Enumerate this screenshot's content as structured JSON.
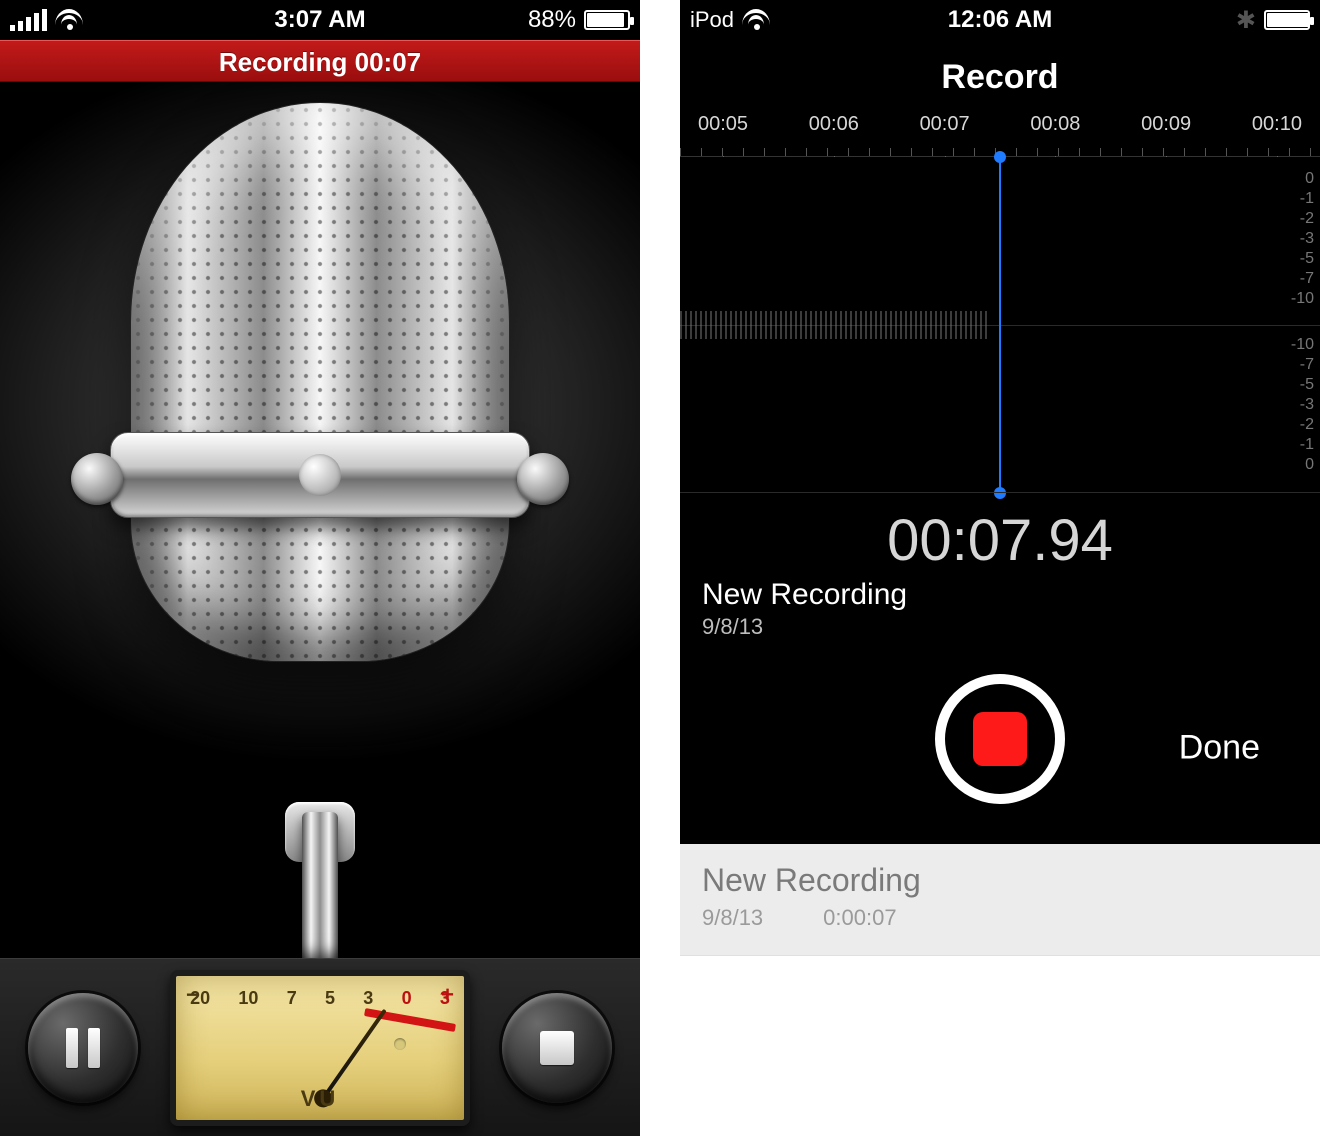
{
  "left": {
    "status": {
      "time": "3:07 AM",
      "battery_pct": "88%",
      "battery_fill": 88
    },
    "banner": "Recording  00:07",
    "vu": {
      "scale": [
        "20",
        "10",
        "7",
        "5",
        "3",
        "0",
        "3"
      ],
      "minus": "−",
      "plus": "+",
      "label": "VU"
    },
    "buttons": {
      "pause": "pause",
      "stop": "stop"
    }
  },
  "right": {
    "status": {
      "carrier": "iPod",
      "time": "12:06 AM",
      "battery_fill": 100
    },
    "title": "Record",
    "ruler": [
      "00:05",
      "00:06",
      "00:07",
      "00:08",
      "00:09",
      "00:10"
    ],
    "db_top": [
      "0",
      "-1",
      "-2",
      "-3",
      "-5",
      "-7",
      "-10"
    ],
    "db_bot": [
      "-10",
      "-7",
      "-5",
      "-3",
      "-2",
      "-1",
      "0"
    ],
    "time": "00:07.94",
    "name": "New Recording",
    "date": "9/8/13",
    "done": "Done",
    "list": [
      {
        "name": "New Recording",
        "date": "9/8/13",
        "duration": "0:00:07"
      }
    ]
  }
}
